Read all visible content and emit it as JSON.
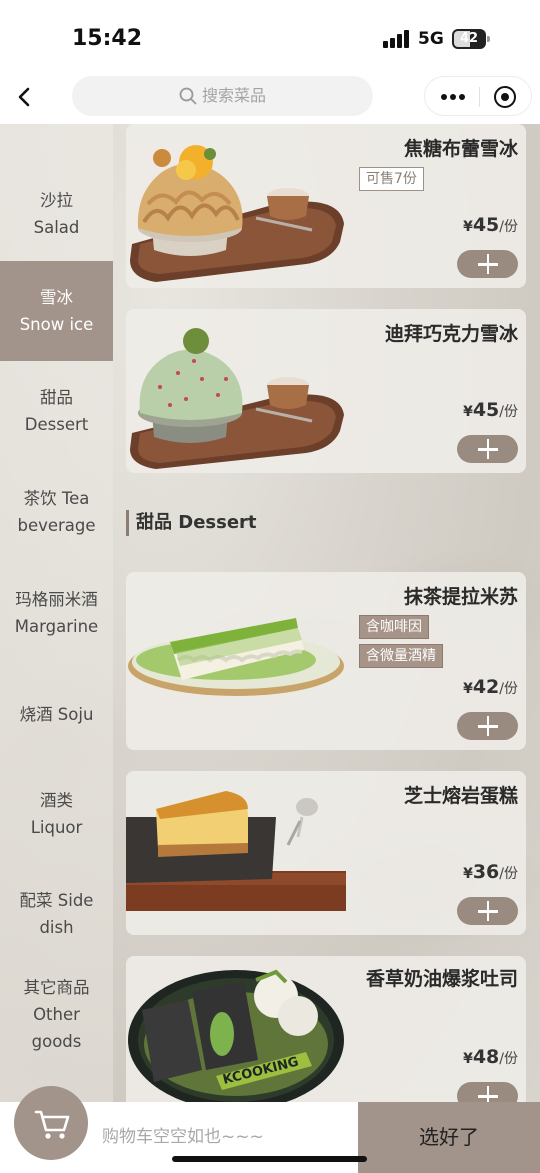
{
  "status_bar": {
    "time": "15:42",
    "network": "5G",
    "battery": "42"
  },
  "navbar": {
    "search_placeholder": "搜索菜品"
  },
  "sidebar": {
    "items": [
      {
        "zh": "沙拉",
        "en": "Salad",
        "active": false
      },
      {
        "zh": "雪冰",
        "en": "Snow ice",
        "active": true
      },
      {
        "zh": "甜品",
        "en": "Dessert",
        "active": false
      },
      {
        "zh": "茶饮 Tea",
        "en": "beverage",
        "active": false
      },
      {
        "zh": "玛格丽米酒",
        "en": "Margarine",
        "active": false
      },
      {
        "zh": "烧酒 Soju",
        "en": "",
        "active": false
      },
      {
        "zh": "酒类",
        "en": "Liquor",
        "active": false
      },
      {
        "zh": "配菜 Side",
        "en": "dish",
        "active": false
      },
      {
        "zh": "其它商品",
        "en": "Other goods",
        "active": false
      }
    ]
  },
  "section": {
    "title": "甜品 Dessert"
  },
  "products": [
    {
      "name": "焦糖布蕾雪冰",
      "tags": [
        "可售7份"
      ],
      "currency": "¥",
      "price": "45",
      "unit": "/份"
    },
    {
      "name": "迪拜巧克力雪冰",
      "tags": [],
      "currency": "¥",
      "price": "45",
      "unit": "/份"
    },
    {
      "name": "抹茶提拉米苏",
      "tags": [
        "含咖啡因",
        "含微量酒精"
      ],
      "currency": "¥",
      "price": "42",
      "unit": "/份"
    },
    {
      "name": "芝士熔岩蛋糕",
      "tags": [],
      "currency": "¥",
      "price": "36",
      "unit": "/份"
    },
    {
      "name": "香草奶油爆浆吐司",
      "tags": [],
      "currency": "¥",
      "price": "48",
      "unit": "/份"
    }
  ],
  "cart": {
    "empty_text": "购物车空空如也~~~",
    "confirm_label": "选好了"
  },
  "colors": {
    "accent": "#a2948a",
    "active_sidebar": "#a2948a"
  }
}
